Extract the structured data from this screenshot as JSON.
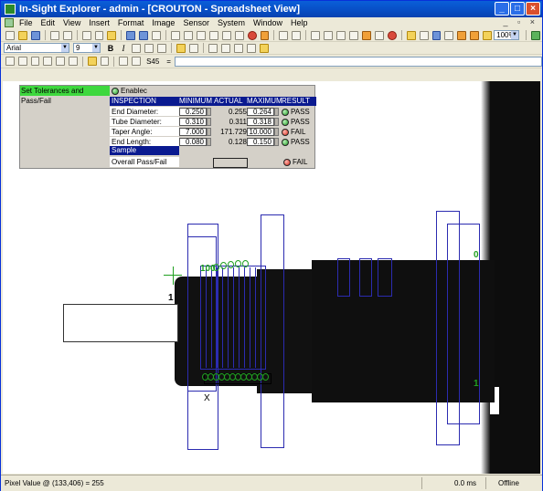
{
  "window": {
    "title": "In-Sight Explorer - admin - [CROUTON - Spreadsheet View]",
    "controls": [
      "_",
      "□",
      "×"
    ],
    "inner_controls": "_ ▫ ×"
  },
  "menu": [
    "File",
    "Edit",
    "View",
    "Insert",
    "Format",
    "Image",
    "Sensor",
    "System",
    "Window",
    "Help"
  ],
  "toolbar2": {
    "font": "Arial",
    "size": "9",
    "bold": "B",
    "italic": "I",
    "zoom": "100%"
  },
  "toolbar3": {
    "cell_ref": "S45",
    "cell_ref_equal": "="
  },
  "spreadsheet": {
    "set_tolerances": "Set Tolerances and Pass/Fail",
    "enable_label": "Enablec",
    "headers": [
      "INSPECTION",
      "MINIMUM",
      "ACTUAL",
      "MAXIMUM",
      "RESULT"
    ],
    "rows": [
      {
        "name": "End Diameter:",
        "min": "0.250",
        "actual": "0.255",
        "max": "0.264",
        "result": "PASS"
      },
      {
        "name": "Tube Diameter:",
        "min": "0.310",
        "actual": "0.311",
        "max": "0.318",
        "result": "PASS"
      },
      {
        "name": "Taper Angle:",
        "min": "7.000",
        "actual": "171.729",
        "max": "10.000",
        "result": "FAIL"
      },
      {
        "name": "End Length:",
        "min": "0.080",
        "actual": "0.128",
        "max": "0.150",
        "result": "PASS"
      }
    ],
    "sample_label": "Sample",
    "overall_label": "Overall Pass/Fail",
    "overall_result": "FAIL"
  },
  "overlay": {
    "label_0_right": "0",
    "label_1_left": "1",
    "label_1_right": "1",
    "label_x": "X",
    "label_100": "100"
  },
  "status": {
    "pixel_value": "Pixel Value @ (133,406) = 255",
    "time": "0.0 ms",
    "mode": "Offline"
  },
  "colors": {
    "pass": "#1e9a1e",
    "fail": "#d42a1a",
    "header_bg": "#0a1a90",
    "tolerance_btn": "#3ed83e",
    "overlay_blue": "#2b2bb0",
    "overlay_green": "#20a020"
  }
}
